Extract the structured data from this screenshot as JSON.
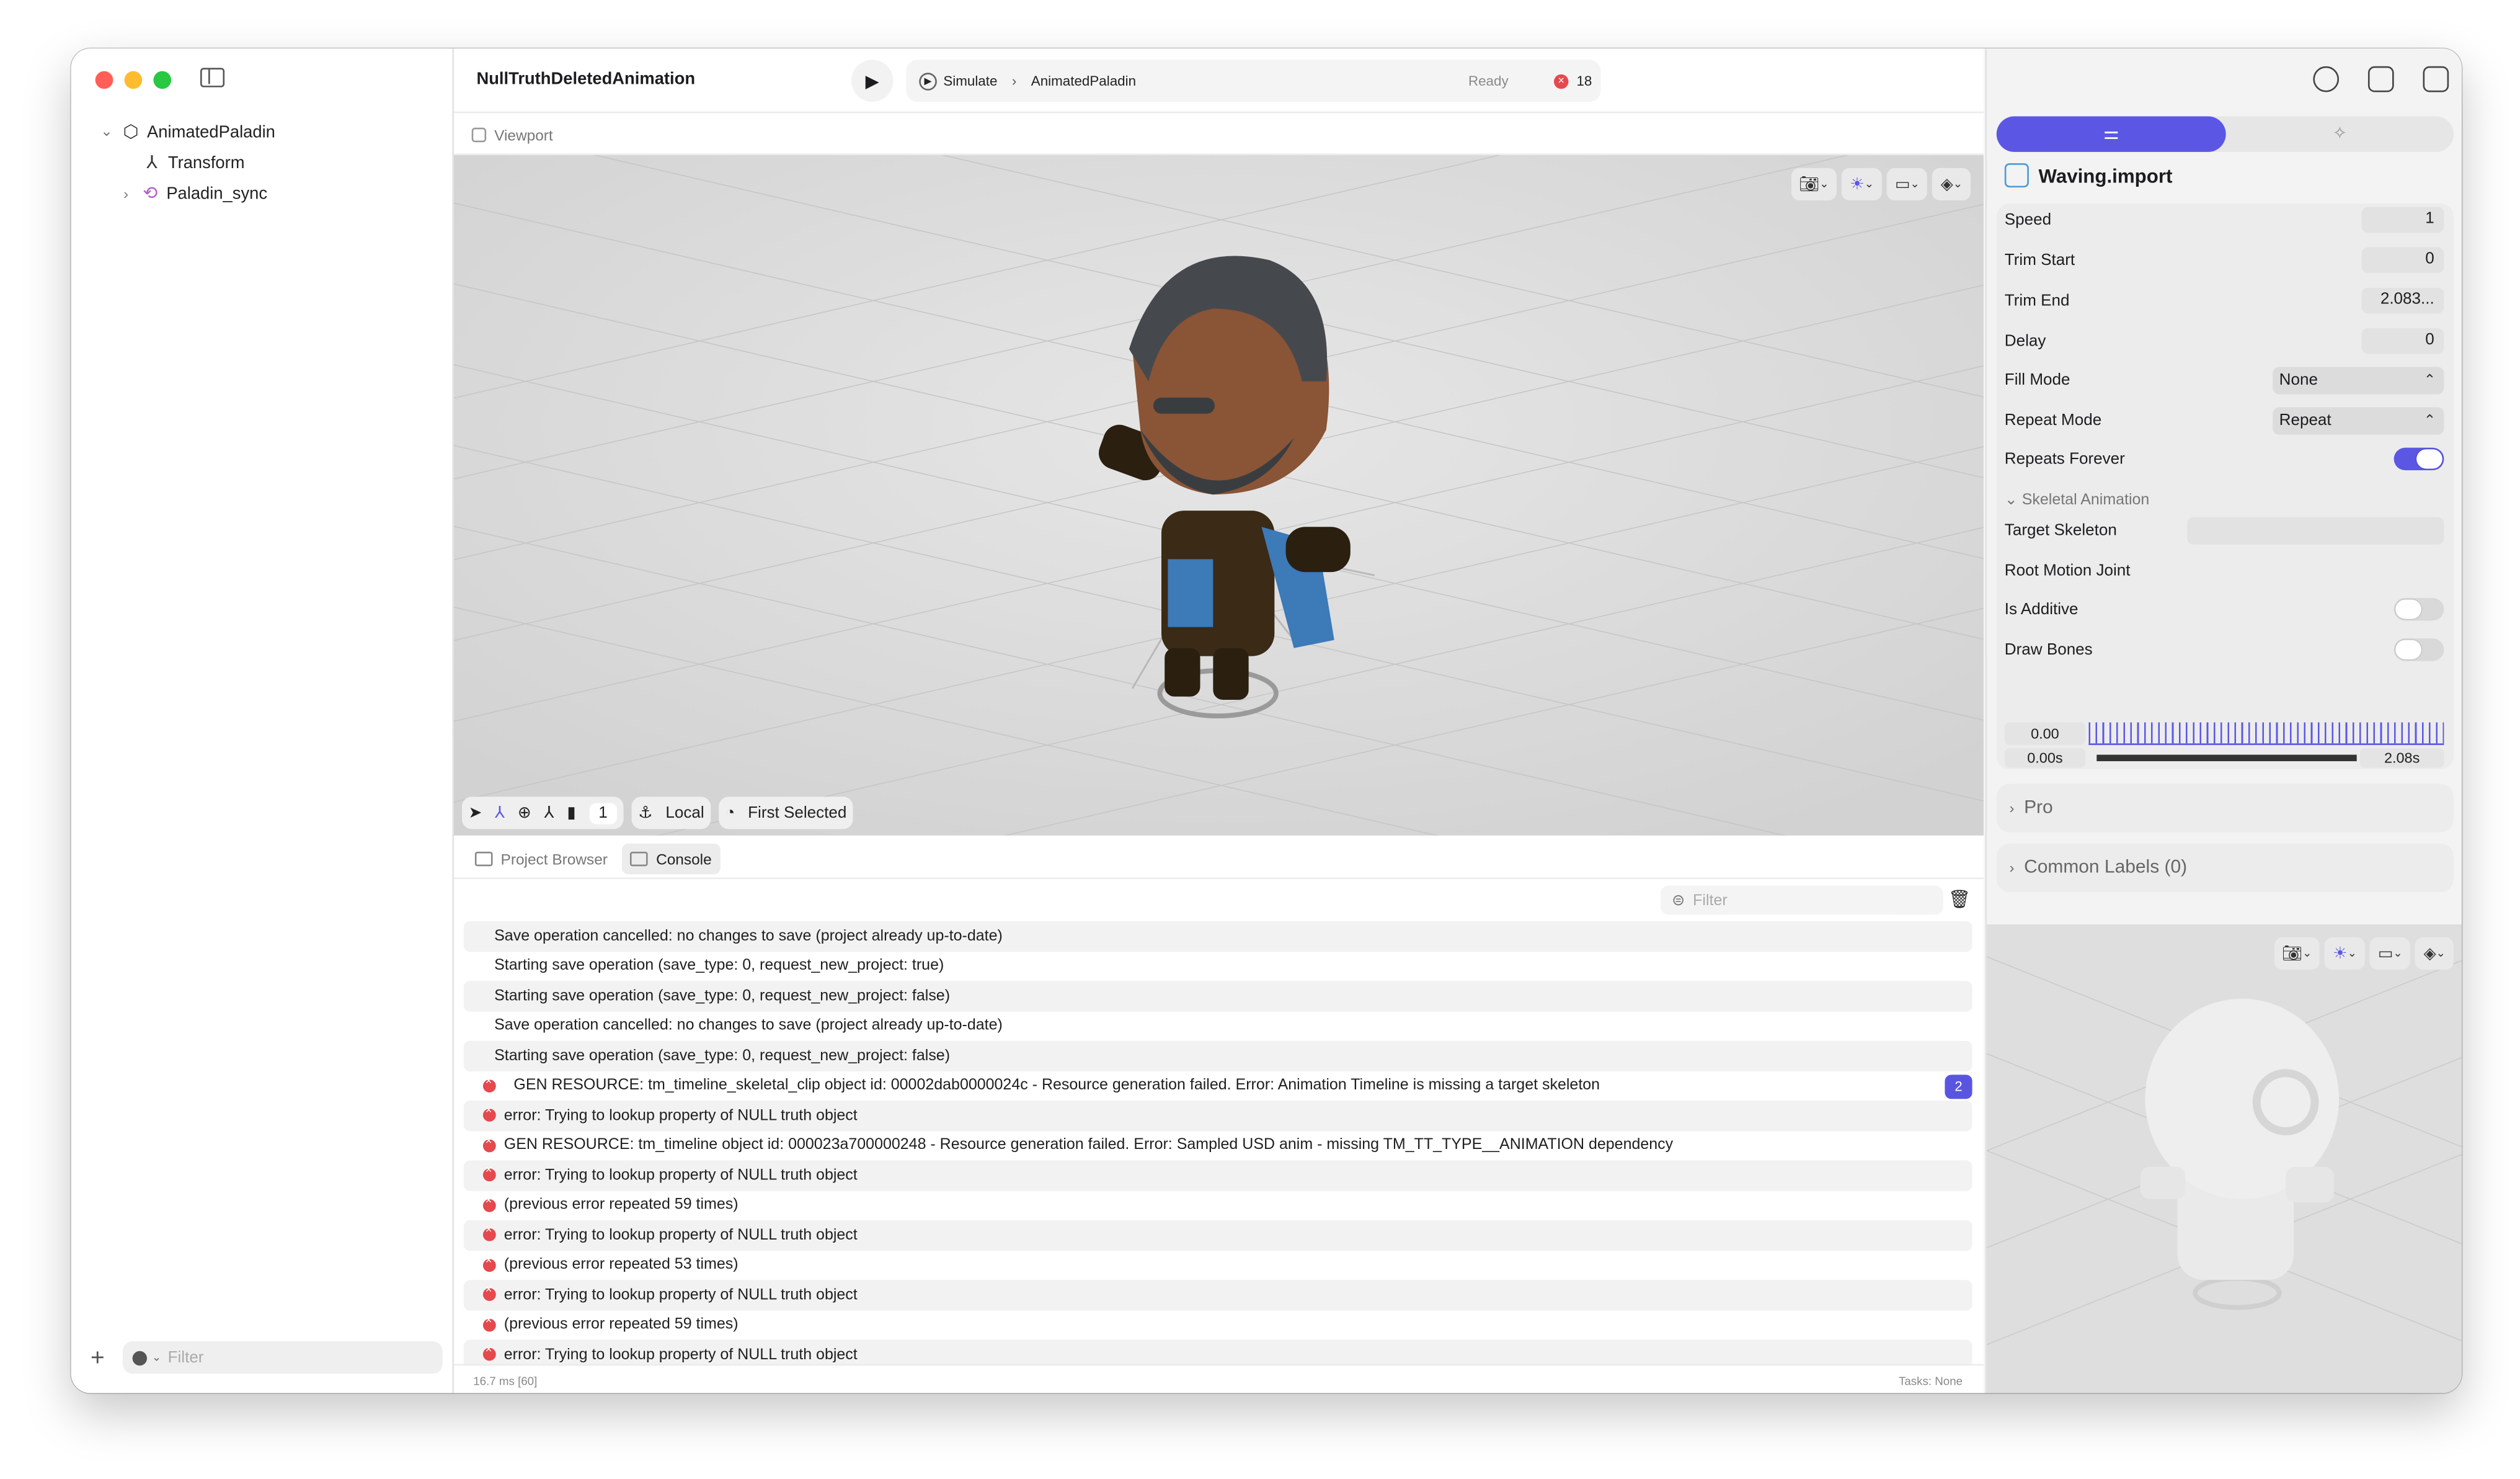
{
  "window": {
    "traffic_colors": [
      "#ff5f57",
      "#febc2e",
      "#28c840"
    ]
  },
  "sidebar": {
    "tree": [
      {
        "label": "AnimatedPaladin",
        "icon": "cube-icon",
        "expanded": true
      },
      {
        "label": "Transform",
        "icon": "transform-axes-icon"
      },
      {
        "label": "Paladin_sync",
        "icon": "animation-link-icon",
        "expanded": false
      }
    ],
    "filter_placeholder": "Filter"
  },
  "toolbar": {
    "document_title": "NullTruthDeletedAnimation",
    "simulate_label": "Simulate",
    "scheme_target": "AnimatedPaladin",
    "status": "Ready",
    "error_count": "18"
  },
  "viewport": {
    "tab_label": "Viewport",
    "selection_count": "1",
    "space_mode": "Local",
    "pivot_mode": "First Selected"
  },
  "bottom_panel": {
    "tabs": [
      "Project Browser",
      "Console"
    ],
    "active_tab": "Console",
    "filter_placeholder": "Filter",
    "log": [
      {
        "text": "Save operation cancelled: no changes to save (project already up-to-date)",
        "error": false
      },
      {
        "text": "Starting save operation (save_type: 0, request_new_project: true)",
        "error": false
      },
      {
        "text": "Starting save operation (save_type: 0, request_new_project: false)",
        "error": false
      },
      {
        "text": "Save operation cancelled: no changes to save (project already up-to-date)",
        "error": false
      },
      {
        "text": "Starting save operation (save_type: 0, request_new_project: false)",
        "error": false
      },
      {
        "text": "GEN RESOURCE: tm_timeline_skeletal_clip object id: 00002dab0000024c - Resource generation failed. Error: Animation Timeline is missing a target skeleton",
        "error": true,
        "badge": "2"
      },
      {
        "text": "error: Trying to lookup property of NULL truth object",
        "error": true
      },
      {
        "text": "GEN RESOURCE: tm_timeline object id: 000023a700000248 - Resource generation failed. Error: Sampled USD anim - missing TM_TT_TYPE__ANIMATION dependency",
        "error": true
      },
      {
        "text": "error: Trying to lookup property of NULL truth object",
        "error": true
      },
      {
        "text": "(previous error repeated 59 times)",
        "error": true
      },
      {
        "text": "error: Trying to lookup property of NULL truth object",
        "error": true
      },
      {
        "text": "(previous error repeated 53 times)",
        "error": true
      },
      {
        "text": "error: Trying to lookup property of NULL truth object",
        "error": true
      },
      {
        "text": "(previous error repeated 59 times)",
        "error": true
      },
      {
        "text": "error: Trying to lookup property of NULL truth object",
        "error": true
      }
    ],
    "status_left": "16.7 ms [60]",
    "status_right": "Tasks: None"
  },
  "inspector": {
    "component_title": "Waving.import",
    "props": {
      "speed": {
        "label": "Speed",
        "value": "1"
      },
      "trim_start": {
        "label": "Trim Start",
        "value": "0"
      },
      "trim_end": {
        "label": "Trim End",
        "value": "2.083..."
      },
      "delay": {
        "label": "Delay",
        "value": "0"
      },
      "fill_mode": {
        "label": "Fill Mode",
        "value": "None"
      },
      "repeat_mode": {
        "label": "Repeat Mode",
        "value": "Repeat"
      },
      "repeats_forever": {
        "label": "Repeats Forever",
        "on": true
      },
      "skeletal_section": "Skeletal Animation",
      "target_skeleton": {
        "label": "Target Skeleton",
        "value": ""
      },
      "root_motion": {
        "label": "Root Motion Joint"
      },
      "is_additive": {
        "label": "Is Additive",
        "on": false
      },
      "draw_bones": {
        "label": "Draw Bones",
        "on": false
      }
    },
    "timeline": {
      "current": "0.00",
      "start": "0.00s",
      "end": "2.08s"
    },
    "sections": [
      "Pro",
      "Common Labels (0)"
    ],
    "accent": "#5b57e4"
  }
}
